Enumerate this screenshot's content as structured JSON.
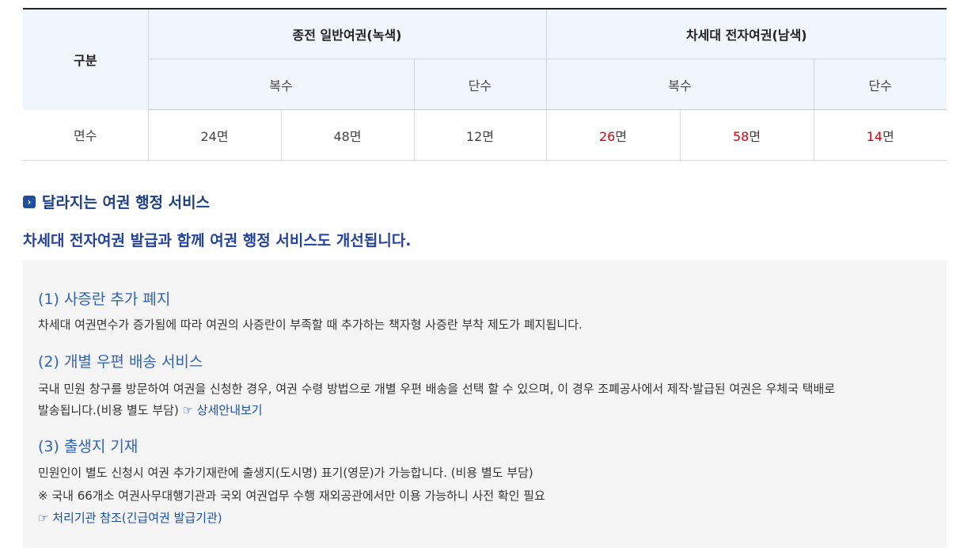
{
  "table": {
    "header_category": "구분",
    "group_old": "종전 일반여권(녹색)",
    "group_new": "차세대 전자여권(남색)",
    "sub_multi_old": "복수",
    "sub_single_old": "단수",
    "sub_multi_new": "복수",
    "sub_single_new": "단수",
    "row_label": "면수",
    "old_multi_1": "24면",
    "old_multi_2": "48면",
    "old_single": "12면",
    "new_multi_1_num": "26",
    "new_multi_2_num": "58",
    "new_single_num": "14",
    "page_unit": "면"
  },
  "section": {
    "title": "달라지는 여권 행정 서비스",
    "lead": "차세대 전자여권 발급과 함께 여권 행정 서비스도 개선됩니다.",
    "icon": "chevron-right-icon",
    "items": [
      {
        "title": "(1) 사증란 추가 폐지",
        "text": "차세대 여권면수가 증가됨에 따라 여권의 사증란이 부족할 때 추가하는 책자형 사증란 부착 제도가 폐지됩니다."
      },
      {
        "title": "(2) 개별 우편 배송 서비스",
        "text_line1": "국내 민원 창구를 방문하여 여권을 신청한 경우, 여권 수령 방법으로 개별 우편 배송을 선택 할 수 있으며, 이 경우 조폐공사에서 제작·발급된 여권은 우체국 택배로",
        "text_line2": "발송됩니다.(비용 별도 부담)",
        "link": "☞ 상세안내보기"
      },
      {
        "title": "(3) 출생지 기재",
        "text_line1": "민원인이 별도 신청시 여권 추가기재란에 출생지(도시명) 표기(영문)가 가능합니다. (비용 별도 부담)",
        "text_line2": "※ 국내 66개소 여권사무대행기관과 국외 여권업무 수행 재외공관에서만 이용 가능하니 사전 확인 필요",
        "link": "☞ 처리기관 참조(긴급여권 발급기관)"
      }
    ]
  },
  "colors": {
    "accent": "#1c3f86",
    "item_title": "#2f64b5",
    "highlight": "#d6000f",
    "header_bg": "#f1f5fd",
    "box_bg": "#f5f5f5"
  }
}
